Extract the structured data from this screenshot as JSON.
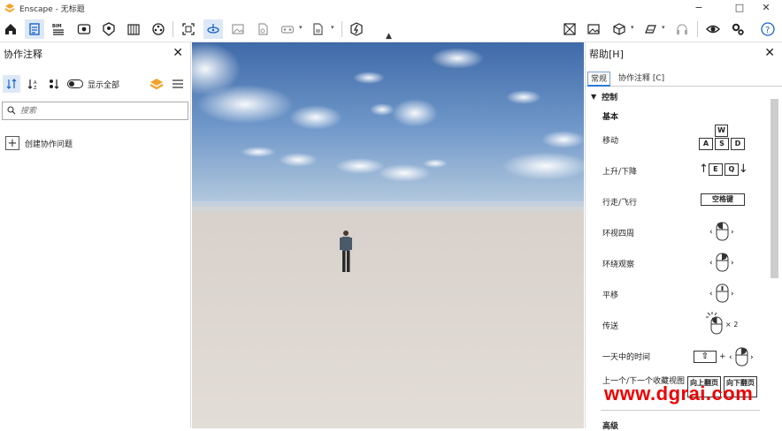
{
  "app": {
    "title": "Enscape - 无标题",
    "brand_color": "#f3a32b"
  },
  "window_controls": {
    "minimize": "−",
    "maximize": "□",
    "close": "✕"
  },
  "toolbar": {
    "left_icons": [
      "home-icon",
      "collab-notes-icon",
      "bim-icon",
      "view-icon",
      "asset-library-icon",
      "material-icon",
      "settings-sphere-icon"
    ],
    "bim_label": "BIM",
    "center_icons": [
      "screenshot-icon",
      "panorama-icon",
      "image-export-icon",
      "pdf-export-icon",
      "vr-icon",
      "exe-export-icon",
      "live-update-icon"
    ],
    "right_icons": [
      "view-management-icon",
      "image-icon",
      "3d-cube-icon",
      "batch-render-icon",
      "headset-icon",
      "eye-icon",
      "gear-icon",
      "help-icon"
    ],
    "help_label": "?"
  },
  "left_panel": {
    "title": "协作注释",
    "show_all_label": "显示全部",
    "search_placeholder": "搜索",
    "create_label": "创建协作问题"
  },
  "right_panel": {
    "title": "帮助[H]",
    "tabs": [
      "常规",
      "协作注释 [C]"
    ],
    "section": "控制",
    "subsection": "基本",
    "rows": [
      {
        "label": "移动"
      },
      {
        "label": "上升/下降"
      },
      {
        "label": "行走/飞行"
      },
      {
        "label": "环视四周"
      },
      {
        "label": "环绕观察"
      },
      {
        "label": "平移"
      },
      {
        "label": "传送"
      },
      {
        "label": "一天中的时间"
      },
      {
        "label": "上一个/下一个收藏视图"
      }
    ],
    "keys": {
      "w": "W",
      "a": "A",
      "s": "S",
      "d": "D",
      "e": "E",
      "q": "Q",
      "space": "空格键",
      "up": "向上翻页",
      "down": "向下翻页",
      "times2": "× 2",
      "plus": "+"
    },
    "advanced": "高级"
  },
  "watermark": "www.dgrai.com"
}
